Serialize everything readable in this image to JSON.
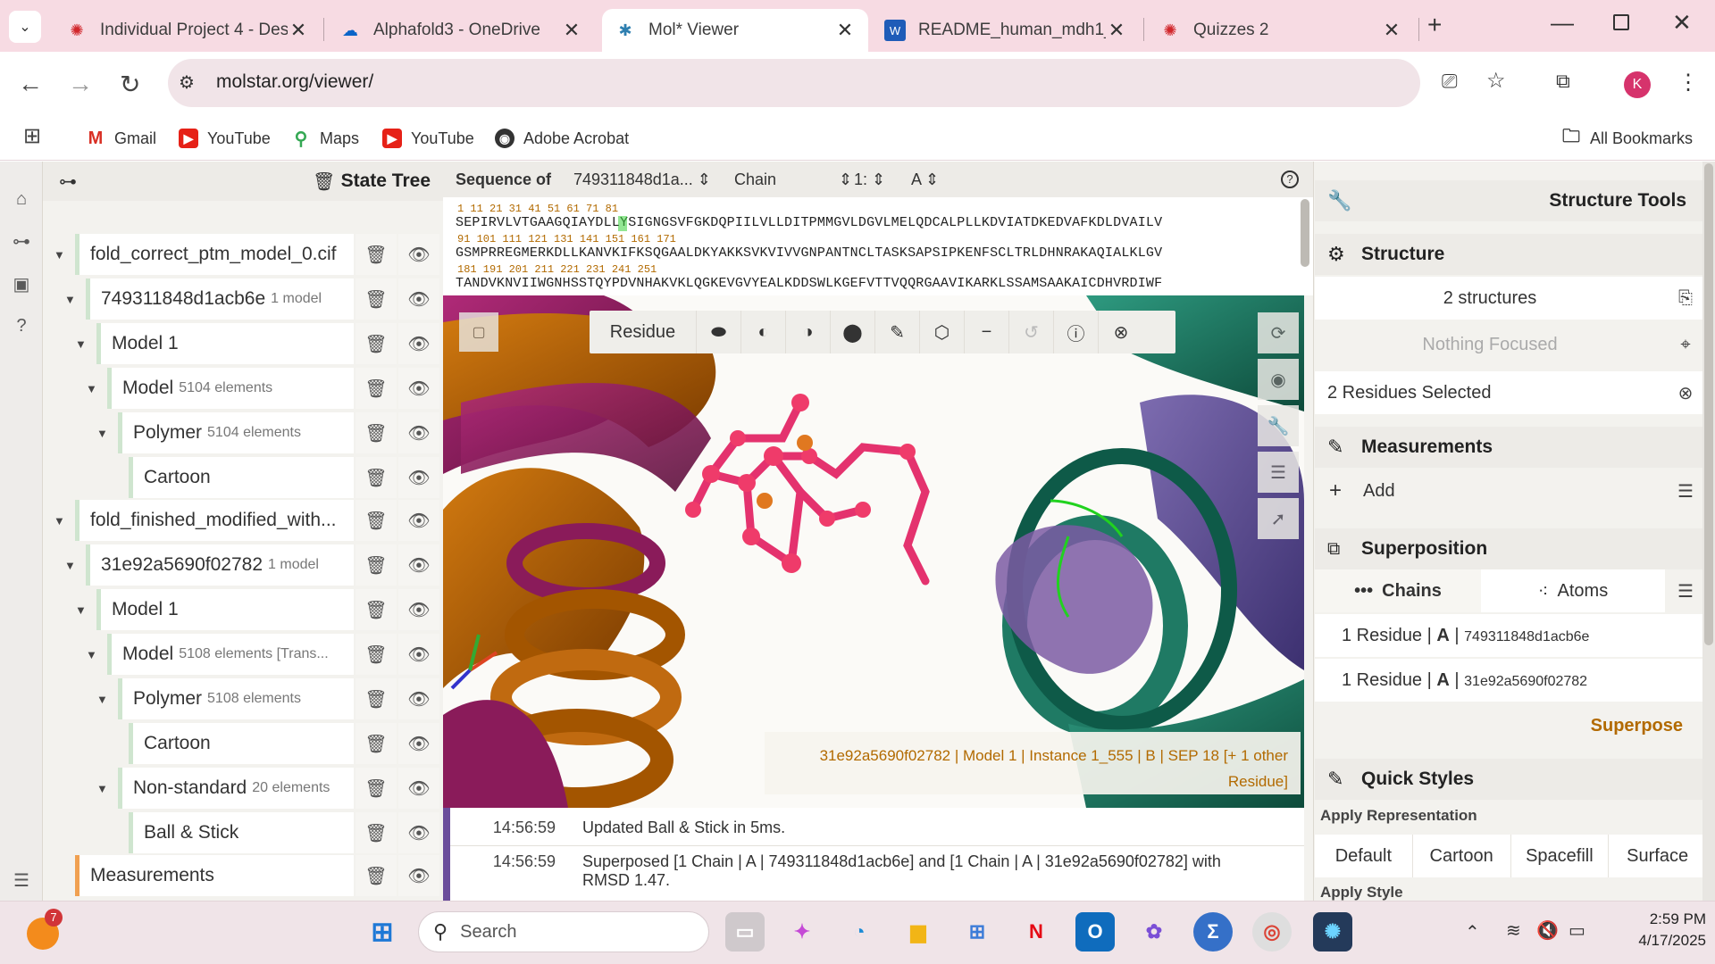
{
  "browser": {
    "tabs": [
      {
        "title": "Individual Project 4 - Des",
        "icon": "canvas-icon"
      },
      {
        "title": "Alphafold3 - OneDrive",
        "icon": "onedrive-icon"
      },
      {
        "title": "Mol* Viewer",
        "icon": "molstar-icon",
        "active": true
      },
      {
        "title": "README_human_mdh1_",
        "icon": "word-icon"
      },
      {
        "title": "Quizzes 2",
        "icon": "canvas-icon"
      }
    ],
    "url": "molstar.org/viewer/",
    "profile_initial": "K",
    "bookmarks": [
      "Gmail",
      "YouTube",
      "Maps",
      "YouTube",
      "Adobe Acrobat"
    ],
    "all_bookmarks": "All Bookmarks"
  },
  "state_tree": {
    "title": "State Tree",
    "rows": [
      {
        "label": "fold_correct_ptm_model_0.cif",
        "meta": ""
      },
      {
        "label": "749311848d1acb6e",
        "meta": "1 model"
      },
      {
        "label": "Model 1",
        "meta": ""
      },
      {
        "label": "Model",
        "meta": "5104 elements"
      },
      {
        "label": "Polymer",
        "meta": "5104 elements"
      },
      {
        "label": "Cartoon",
        "meta": ""
      },
      {
        "label": "fold_finished_modified_with...",
        "meta": ""
      },
      {
        "label": "31e92a5690f02782",
        "meta": "1 model"
      },
      {
        "label": "Model 1",
        "meta": ""
      },
      {
        "label": "Model",
        "meta": "5108 elements [Trans..."
      },
      {
        "label": "Polymer",
        "meta": "5108 elements"
      },
      {
        "label": "Cartoon",
        "meta": ""
      },
      {
        "label": "Non-standard",
        "meta": "20 elements"
      },
      {
        "label": "Ball & Stick",
        "meta": ""
      },
      {
        "label": "Measurements",
        "meta": ""
      }
    ]
  },
  "sequence": {
    "label": "Sequence of",
    "structure": "749311848d1a...",
    "mode": "Chain",
    "entity": "1:",
    "chain": "A",
    "lines": [
      {
        "numbers": "1         11        21        31        41        51        61        71        81",
        "residues": "SEPIRVLVTGAAGQIAYDLLYSIGNGSVFGKDQPIILVLLDITPMMGVLDGVLMELQDCALPLLKDVIATDKEDVAFKDLDVAILV"
      },
      {
        "numbers": "    91        101       111       121       131       141       151       161       171",
        "residues": "GSMPRREGMERKDLLKANVKIFKSQGAALDKYAKKSVKVIVVGNPANTNCLTASKSAPSIPKENFSCLTRLDHNRAKAQIALKLGV"
      },
      {
        "numbers": "        181       191       201       211       221       231       241       251",
        "residues": "TANDVKNVIIWGNHSSTQYPDVNHAKVKLQGKEVGVYEALKDDSWLKGEFVTTVQQRGAAVIKARKLSSAMSAAKAICDHVRDIWF"
      }
    ]
  },
  "viewport_toolbar": {
    "mode": "Residue"
  },
  "hover_info": {
    "line1": "31e92a5690f02782 | Model 1 | Instance 1_555 | B | SEP 18 [+ 1 other",
    "line2": "Residue]"
  },
  "log": [
    {
      "time": "14:56:59",
      "message": "Updated Ball & Stick in 5ms."
    },
    {
      "time": "14:56:59",
      "message": "Superposed [1 Chain | A | 749311848d1acb6e] and [1 Chain | A | 31e92a5690f02782] with",
      "message2": "RMSD 1.47."
    }
  ],
  "structure_tools": {
    "title": "Structure Tools",
    "structure_section": "Structure",
    "structures_count": "2 structures",
    "focus": "Nothing Focused",
    "selection": "2 Residues Selected",
    "measurements_section": "Measurements",
    "add_label": "Add",
    "superposition_section": "Superposition",
    "chains_tab": "Chains",
    "atoms_tab": "Atoms",
    "super_items": [
      {
        "count": "1 Residue",
        "chain": "A",
        "id": "749311848d1acb6e"
      },
      {
        "count": "1 Residue",
        "chain": "A",
        "id": "31e92a5690f02782"
      }
    ],
    "superpose_button": "Superpose",
    "quick_styles_section": "Quick Styles",
    "apply_representation": "Apply Representation",
    "rep_buttons": [
      "Default",
      "Cartoon",
      "Spacefill",
      "Surface"
    ],
    "apply_style": "Apply Style"
  },
  "taskbar": {
    "search_placeholder": "Search",
    "notification_badge": "7",
    "time": "2:59 PM",
    "date": "4/17/2025"
  },
  "colors": {
    "accent_orange": "#b26a00",
    "log_purple": "#6b4d9b",
    "tab_bg": "#f7dbe3"
  }
}
